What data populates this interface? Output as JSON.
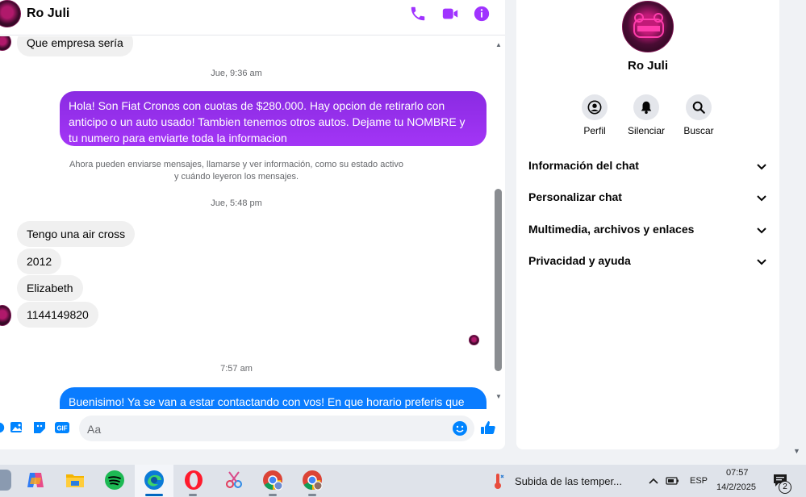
{
  "chat": {
    "contact_name": "Ro Juli",
    "messages": {
      "first_incoming": "Que empresa sería",
      "time_1": "Jue, 9:36 am",
      "outgoing_1": "Hola! Son Fiat Cronos con cuotas de $280.000. Hay opcion de retirarlo con anticipo o un auto usado! Tambien tenemos otros autos. Dejame tu NOMBRE y tu numero para enviarte toda la informacion",
      "system_line_1": "Ahora pueden enviarse mensajes, llamarse y ver información, como su estado activo",
      "system_line_2": "y cuándo leyeron los mensajes.",
      "time_2": "Jue, 5:48 pm",
      "incoming_1": "Tengo una air cross",
      "incoming_2": "2012",
      "incoming_3": "Elizabeth",
      "incoming_4": "1144149820",
      "time_3": "7:57 am",
      "outgoing_2": "Buenisimo! Ya se van a estar contactando con vos! En que horario preferis que se"
    },
    "composer": {
      "placeholder": "Aa"
    }
  },
  "info": {
    "profile_name": "Ro Juli",
    "actions": [
      {
        "label": "Perfil",
        "icon": "profile-icon"
      },
      {
        "label": "Silenciar",
        "icon": "bell-icon"
      },
      {
        "label": "Buscar",
        "icon": "search-icon"
      }
    ],
    "sections": [
      "Información del chat",
      "Personalizar chat",
      "Multimedia, archivos y enlaces",
      "Privacidad y ayuda"
    ]
  },
  "taskbar": {
    "weather_text": "Subida de las temper...",
    "language": "ESP",
    "time": "07:57",
    "date": "14/2/2025",
    "notification_count": "2"
  },
  "colors": {
    "messenger_purple": "#a033ff",
    "outgoing_gradient_top": "#8a2be2",
    "outgoing_blue": "#0a7cff",
    "accent_blue": "#0084ff"
  }
}
